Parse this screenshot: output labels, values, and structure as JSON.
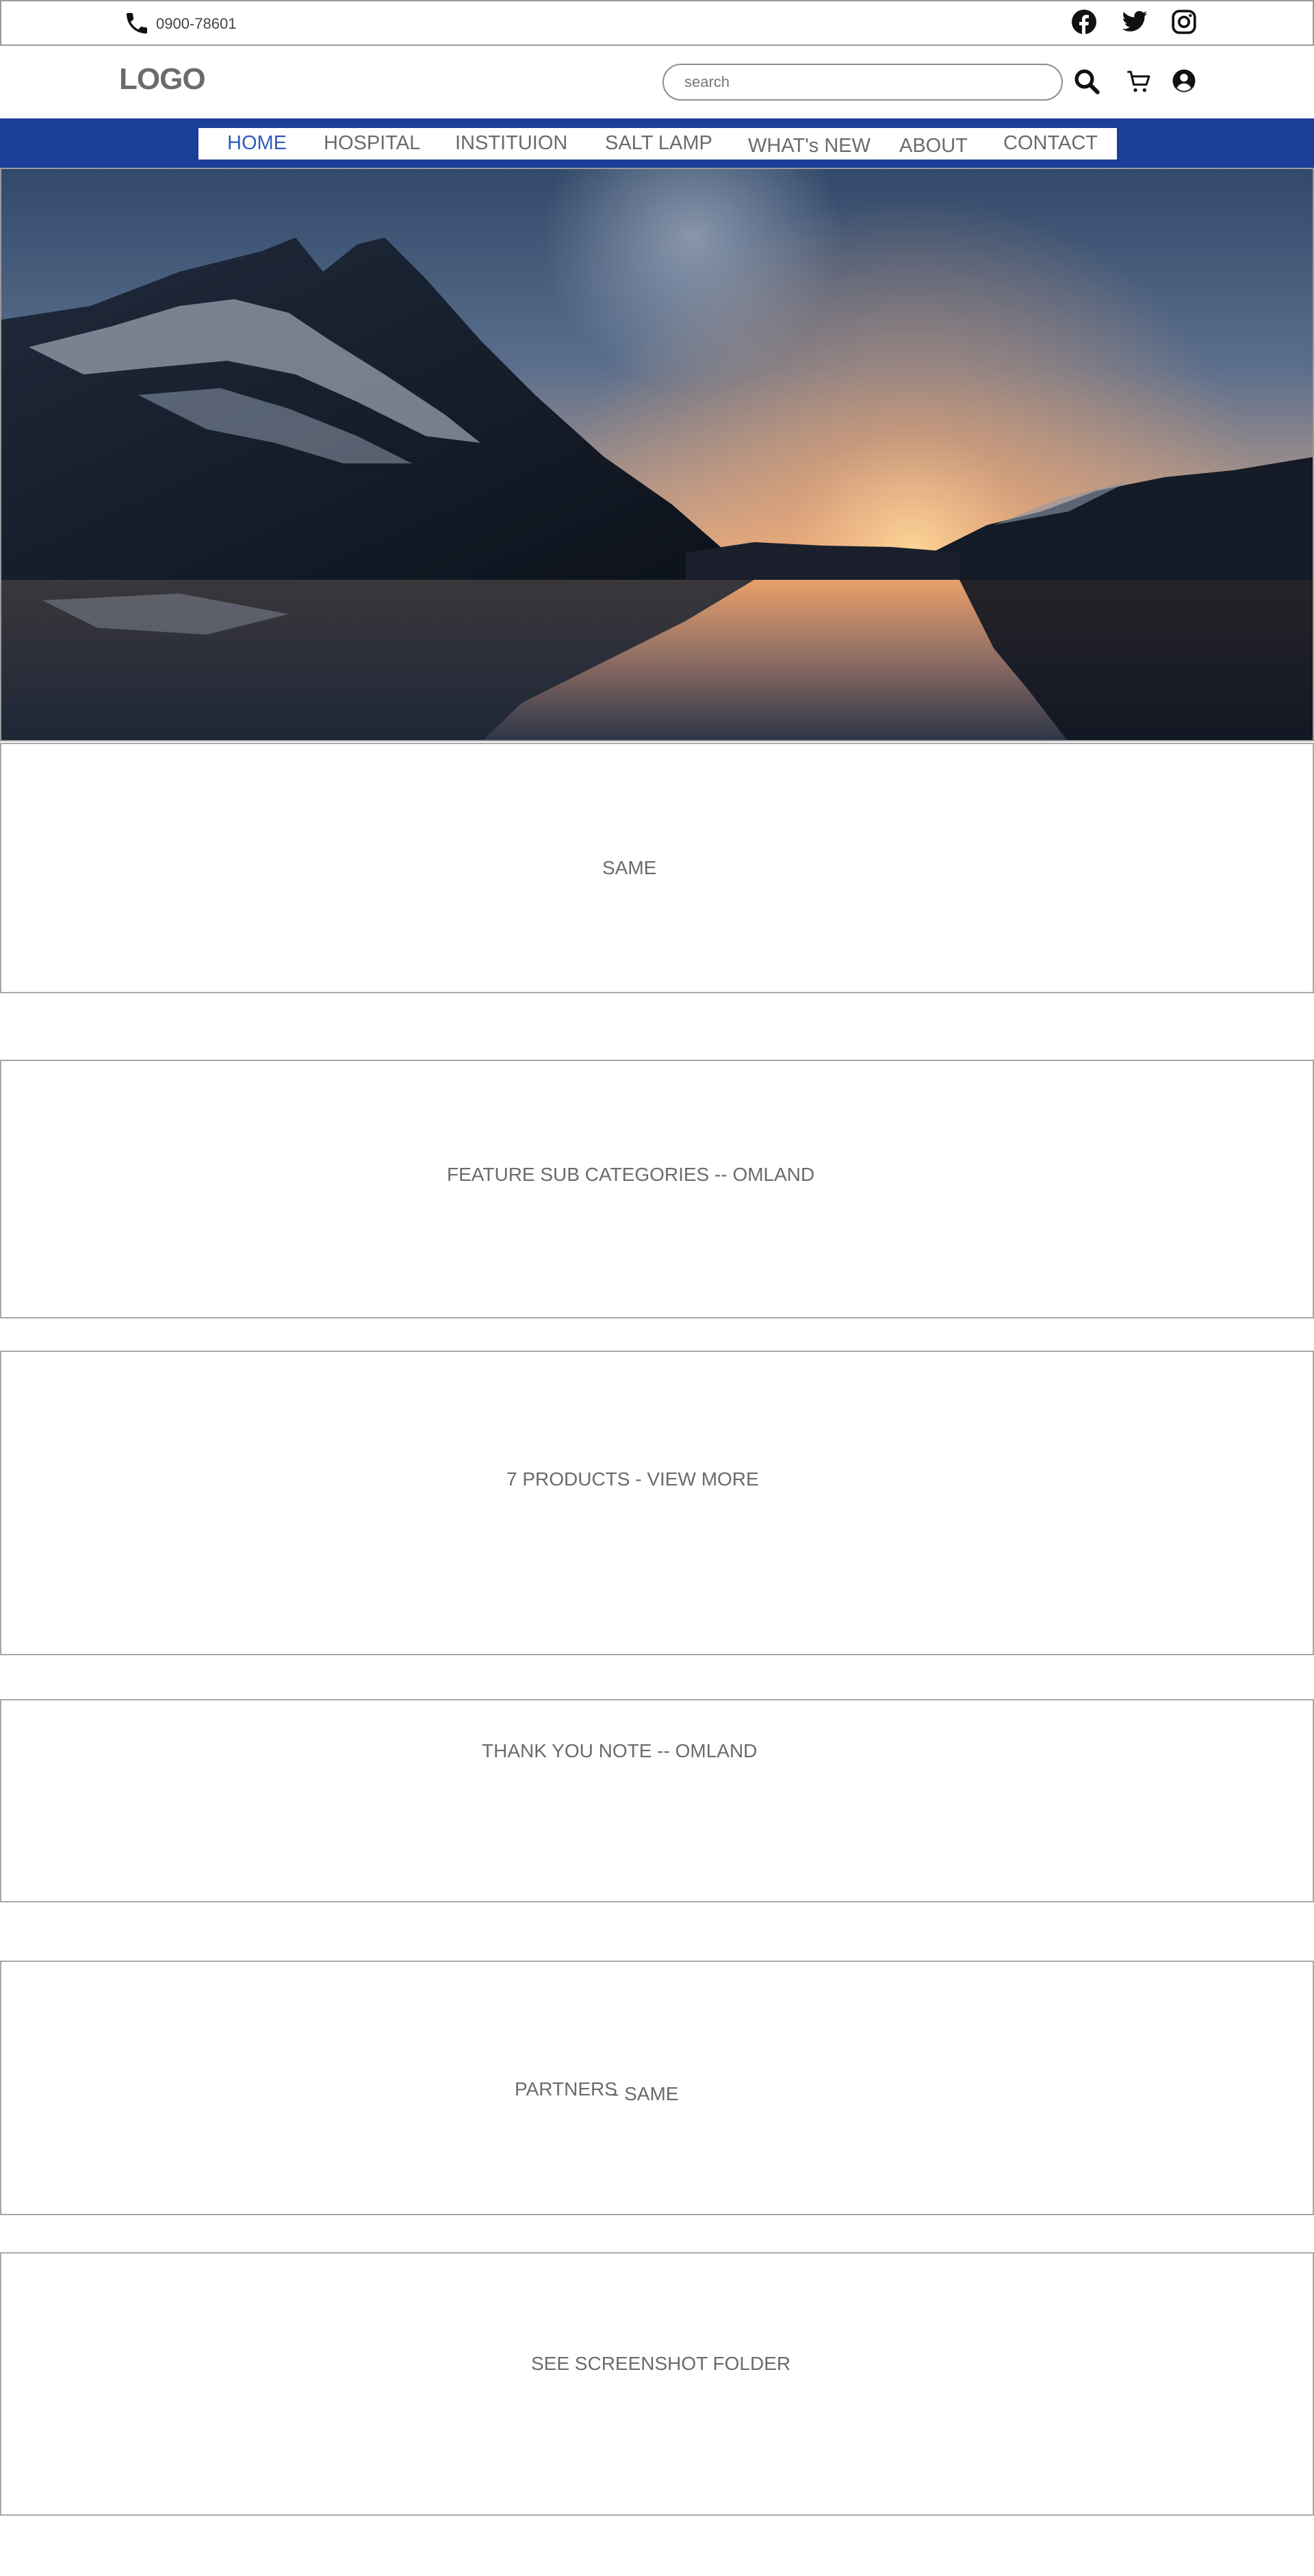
{
  "topbar": {
    "phone_icon": "phone-icon",
    "phone": "0900-78601",
    "social_icons": [
      "facebook-icon",
      "twitter-icon",
      "instagram-icon"
    ]
  },
  "header": {
    "logo": "LOGO",
    "search_placeholder": "search",
    "icons": [
      "search-icon",
      "cart-icon",
      "user-icon"
    ]
  },
  "nav": {
    "items": [
      "HOME",
      "HOSPITAL",
      "INSTITUION",
      "SALT LAMP",
      "WHAT's NEW",
      "ABOUT",
      "CONTACT"
    ],
    "active": "HOME"
  },
  "colors": {
    "nav_bar": "#1b3f98",
    "nav_active": "#2f5bbd",
    "text": "#6b6b6b"
  },
  "sections": {
    "s1": "SAME",
    "s2": "FEATURE SUB CATEGORIES -- OMLAND",
    "s3": "7 PRODUCTS - VIEW MORE",
    "s4": "THANK YOU NOTE -- OMLAND",
    "s5_a": "PARTNERS",
    "s5_b": "- SAME",
    "s6": "SEE SCREENSHOT FOLDER"
  }
}
